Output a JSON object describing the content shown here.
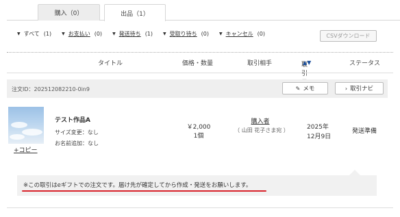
{
  "tabs": [
    {
      "label": "購入（0）",
      "active": false
    },
    {
      "label": "出品（1）",
      "active": true
    }
  ],
  "filters": [
    {
      "label": "すべて",
      "count": "(1)",
      "underlined": false
    },
    {
      "label": "お支払い",
      "count": "(0)",
      "underlined": true
    },
    {
      "label": "発送待ち",
      "count": "(1)",
      "underlined": true
    },
    {
      "label": "受取り待ち",
      "count": "(0)",
      "underlined": true
    },
    {
      "label": "キャンセル",
      "count": "(0)",
      "underlined": true
    }
  ],
  "csv_button": "CSVダウンロード",
  "columns": {
    "title": "タイトル",
    "price_qty": "価格・数量",
    "partner": "取引相手",
    "date": "取引日",
    "date_sort": "▲▼",
    "status": "ステータス"
  },
  "order": {
    "id_text": "注文ID：202512082210-0in9",
    "memo_button": "メモ",
    "navi_button": "取引ナビ",
    "item_title": "テスト作品A",
    "option1": "サイズ変更：なし",
    "option2": "お名前追加：なし",
    "copy_link": "+コピー",
    "price": "￥2,000",
    "quantity": "1個",
    "buyer_label": "購入者",
    "buyer_name": "（ 山田 花子さま宛 ）",
    "date_year": "2025年",
    "date_day": "12月9日",
    "status": "発送準備"
  },
  "notice": "※この取引はeギフトでの注文です。届け先が確定してから作成・発送をお願いします。",
  "colors": {
    "accent_underline": "#d9222a",
    "sort_arrow": "#1a4e9a"
  },
  "icons": {
    "memo": "pencil-icon",
    "navi": "chevron-right-icon",
    "filter": "triangle-down-icon"
  }
}
